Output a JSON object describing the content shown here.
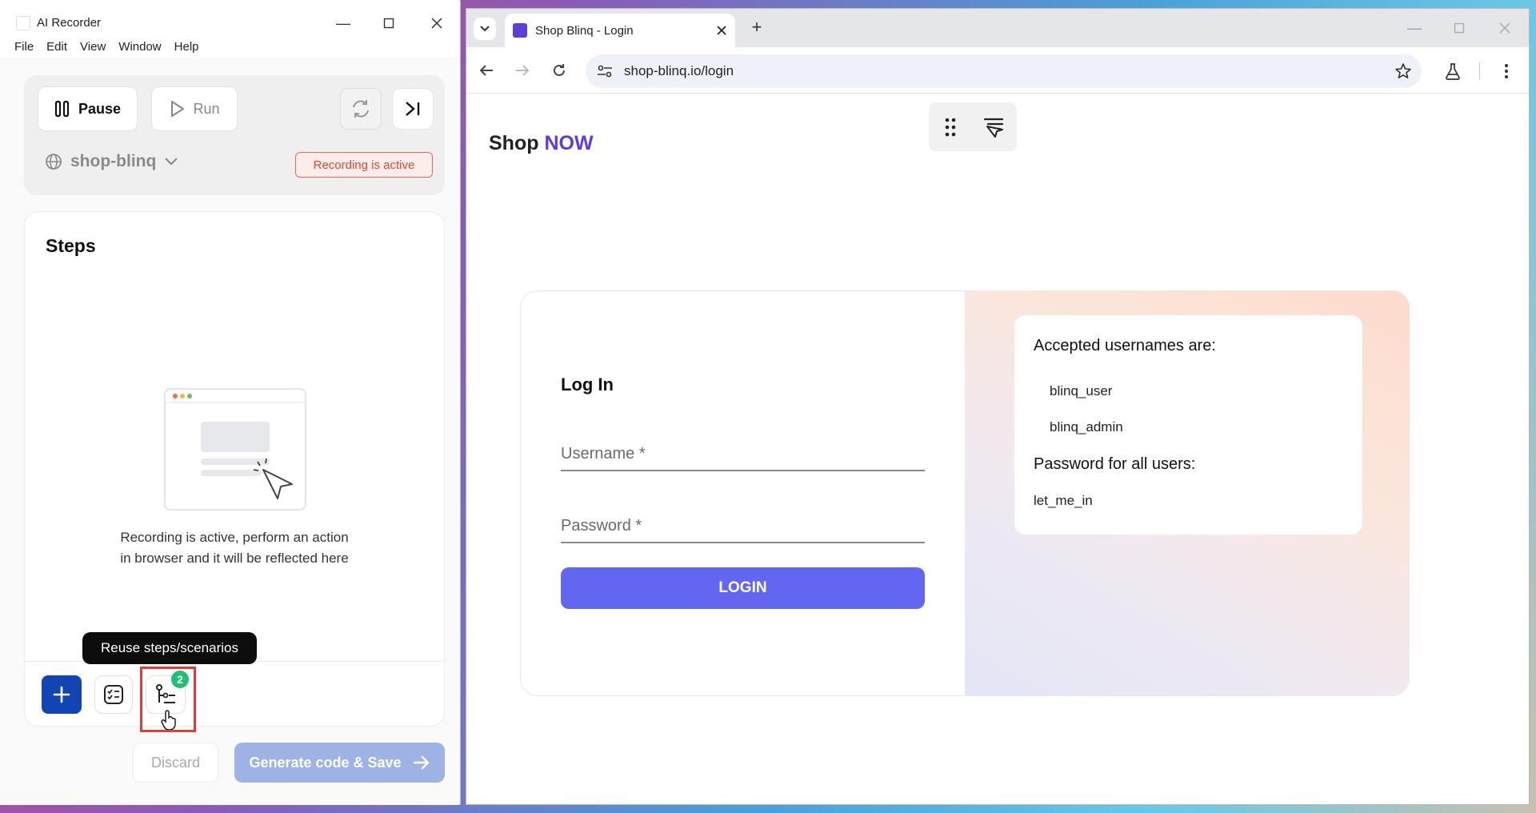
{
  "recorder": {
    "title": "AI Recorder",
    "menu": [
      "File",
      "Edit",
      "View",
      "Window",
      "Help"
    ],
    "controls": {
      "pause_label": "Pause",
      "run_label": "Run",
      "env_name": "shop-blinq",
      "status_badge": "Recording is active"
    },
    "steps": {
      "title": "Steps",
      "empty_line1": "Recording is active, perform an action",
      "empty_line2": "in browser and it will be reflected here"
    },
    "tooltip": "Reuse steps/scenarios",
    "reuse_count": "2",
    "footer": {
      "discard_label": "Discard",
      "generate_label": "Generate code & Save"
    }
  },
  "browser": {
    "tab_title": "Shop Blinq - Login",
    "url": "shop-blinq.io/login",
    "page": {
      "brand_prefix": "Shop",
      "brand_accent": "NOW",
      "login": {
        "heading": "Log In",
        "username_label": "Username *",
        "password_label": "Password *",
        "button_label": "LOGIN"
      },
      "info": {
        "usernames_heading": "Accepted usernames are:",
        "usernames": [
          "blinq_user",
          "blinq_admin"
        ],
        "password_heading": "Password for all users:",
        "password": "let_me_in"
      }
    }
  },
  "colors": {
    "accent": "#6366f1",
    "brand_accent": "#5a3de0",
    "recording_red": "#d74a36",
    "primary_blue": "#1245b3",
    "badge_green": "#1fbf7a"
  }
}
